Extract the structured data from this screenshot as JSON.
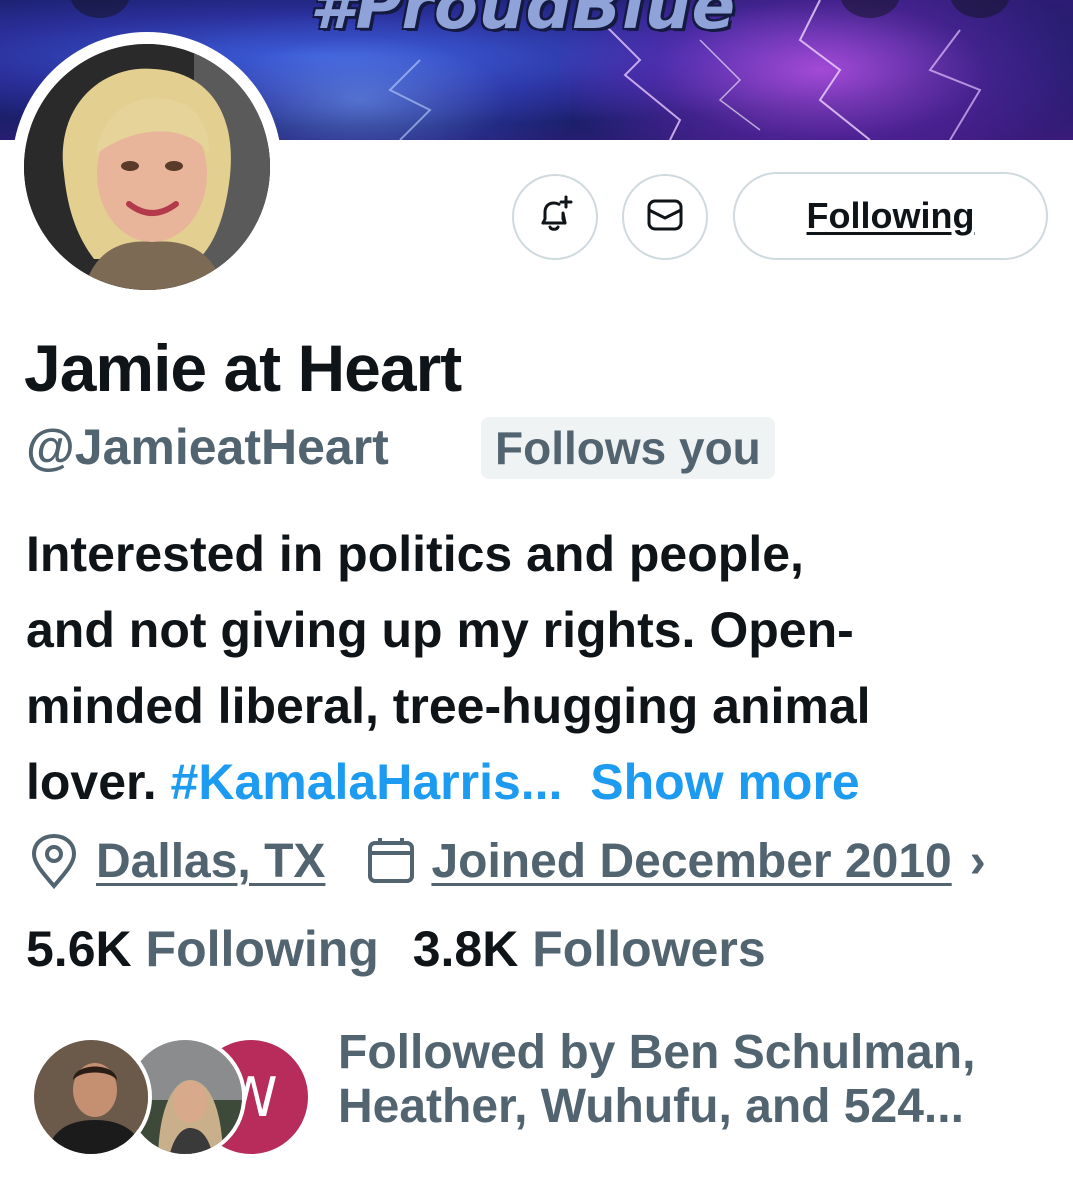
{
  "banner": {
    "tag": "#ProudBlue"
  },
  "profile": {
    "name": "Jamie at Heart",
    "handle": "@JamieatHeart",
    "follows_you": "Follows you",
    "bio": {
      "line1": "Interested in politics and people,",
      "line2": "and not giving up my rights. Open-",
      "line3": "minded liberal, tree-hugging animal",
      "line4_text": "lover.",
      "hashtag": "#KamalaHarris...",
      "show_more": "Show more"
    },
    "location": "Dallas, TX",
    "joined": "Joined December 2010",
    "overflow_glyph": "›",
    "following_count": "5.6K",
    "following_label": "Following",
    "followers_count": "3.8K",
    "followers_label": "Followers",
    "followed_by_line1": "Followed by Ben Schulman,",
    "followed_by_line2": "Heather, Wuhufu, and 524...",
    "wuhufu_initial": "W"
  },
  "actions": {
    "notify_icon": "bell-plus-icon",
    "message_icon": "envelope-icon",
    "follow_state": "Following"
  },
  "colors": {
    "primary_text": "#0f1419",
    "secondary_text": "#536471",
    "link": "#1d9bf0",
    "border": "#cfd9de",
    "badge_bg": "#eff3f4",
    "wuhufu_avatar": "#b72c5a"
  }
}
